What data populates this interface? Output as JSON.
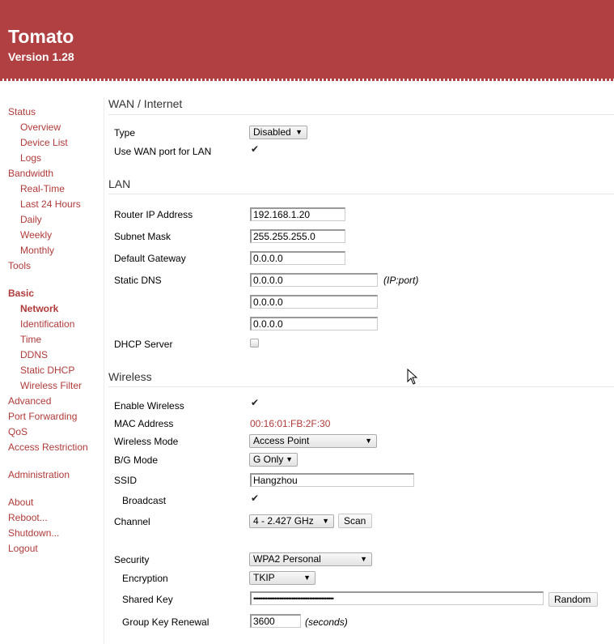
{
  "header": {
    "title": "Tomato",
    "version": "Version 1.28",
    "bg_color": "#b04042"
  },
  "sidebar": {
    "items": [
      {
        "label": "Status",
        "level": 0
      },
      {
        "label": "Overview",
        "level": 1
      },
      {
        "label": "Device List",
        "level": 1
      },
      {
        "label": "Logs",
        "level": 1
      },
      {
        "label": "Bandwidth",
        "level": 0
      },
      {
        "label": "Real-Time",
        "level": 1
      },
      {
        "label": "Last 24 Hours",
        "level": 1
      },
      {
        "label": "Daily",
        "level": 1
      },
      {
        "label": "Weekly",
        "level": 1
      },
      {
        "label": "Monthly",
        "level": 1
      },
      {
        "label": "Tools",
        "level": 0
      },
      {
        "label": "Basic",
        "level": 0,
        "active": true
      },
      {
        "label": "Network",
        "level": 1,
        "active": true
      },
      {
        "label": "Identification",
        "level": 1
      },
      {
        "label": "Time",
        "level": 1
      },
      {
        "label": "DDNS",
        "level": 1
      },
      {
        "label": "Static DHCP",
        "level": 1
      },
      {
        "label": "Wireless Filter",
        "level": 1
      },
      {
        "label": "Advanced",
        "level": 0
      },
      {
        "label": "Port Forwarding",
        "level": 0
      },
      {
        "label": "QoS",
        "level": 0
      },
      {
        "label": "Access Restriction",
        "level": 0
      },
      {
        "label": "Administration",
        "level": 0
      },
      {
        "label": "About",
        "level": 0
      },
      {
        "label": "Reboot...",
        "level": 0
      },
      {
        "label": "Shutdown...",
        "level": 0
      },
      {
        "label": "Logout",
        "level": 0
      }
    ],
    "link_color": "#b03a3a"
  },
  "wan": {
    "title": "WAN / Internet",
    "type_label": "Type",
    "type_value": "Disabled",
    "use_wan_port_label": "Use WAN port for LAN",
    "use_wan_port_checked": true
  },
  "lan": {
    "title": "LAN",
    "router_ip_label": "Router IP Address",
    "router_ip_value": "192.168.1.20",
    "subnet_label": "Subnet Mask",
    "subnet_value": "255.255.255.0",
    "gateway_label": "Default Gateway",
    "gateway_value": "0.0.0.0",
    "dns_label": "Static DNS",
    "dns_values": [
      "0.0.0.0",
      "0.0.0.0",
      "0.0.0.0"
    ],
    "dns_note": "(IP:port)",
    "dhcp_label": "DHCP Server",
    "dhcp_checked": false
  },
  "wireless": {
    "title": "Wireless",
    "enable_label": "Enable Wireless",
    "enable_checked": true,
    "mac_label": "MAC Address",
    "mac_value": "00:16:01:FB:2F:30",
    "mode_label": "Wireless Mode",
    "mode_value": "Access Point",
    "bg_label": "B/G Mode",
    "bg_value": "G Only",
    "ssid_label": "SSID",
    "ssid_value": "Hangzhou",
    "broadcast_label": "Broadcast",
    "broadcast_checked": true,
    "channel_label": "Channel",
    "channel_value": "4 - 2.427 GHz",
    "scan_label": "Scan",
    "security_label": "Security",
    "security_value": "WPA2 Personal",
    "encryption_label": "Encryption",
    "encryption_value": "TKIP",
    "shared_key_label": "Shared Key",
    "shared_key_value": "••••••••••••••••••••••••••••••••••••••••••••••",
    "random_label": "Random",
    "group_key_label": "Group Key Renewal",
    "group_key_value": "3600",
    "group_key_note": "(seconds)"
  },
  "icons": {
    "check": "✔",
    "dropdown_arrow": "▼",
    "cursor": "mouse-pointer"
  }
}
